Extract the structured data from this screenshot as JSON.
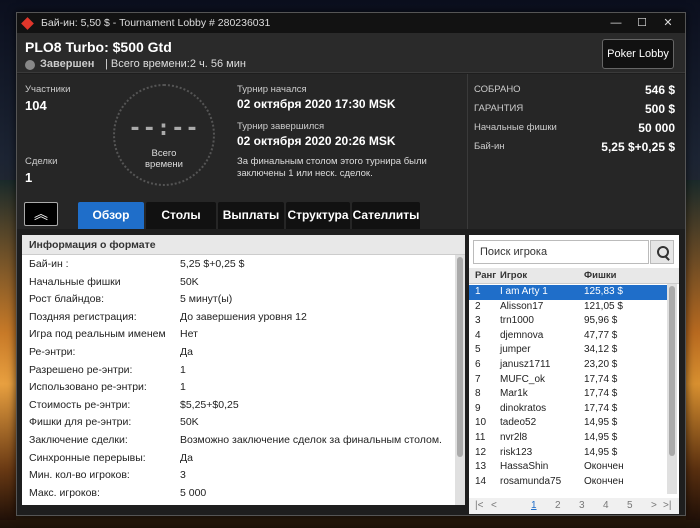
{
  "window": {
    "title": "Бай-ин: 5,50 $ - Tournament Lobby # 280236031"
  },
  "header": {
    "tournament_name": "PLO8 Turbo: $500 Gtd",
    "status": "Завершен",
    "total_time": "| Всего времени:2 ч. 56 мин",
    "poker_lobby_button": "Poker Lobby"
  },
  "stats": {
    "participants_label": "Участники",
    "participants_value": "104",
    "deals_label": "Сделки",
    "deals_value": "1"
  },
  "clock": {
    "display": "--:--",
    "caption_line1": "Всего",
    "caption_line2": "времени"
  },
  "schedule": {
    "start_label": "Турнир начался",
    "start_value": "02 октября 2020  17:30 MSK",
    "end_label": "Турнир завершился",
    "end_value": "02 октября 2020  20:26 MSK",
    "note": "За финальным столом этого турнира были заключены 1 или неск. сделок."
  },
  "prize": {
    "collected_label": "СОБРАНО",
    "collected_value": "546 $",
    "guarantee_label": "ГАРАНТИЯ",
    "guarantee_value": "500 $",
    "chips_label": "Начальные фишки",
    "chips_value": "50 000",
    "buyin_label": "Бай-ин",
    "buyin_value": "5,25 $+0,25 $"
  },
  "tabs": [
    {
      "label": "Обзор",
      "active": true
    },
    {
      "label": "Столы",
      "active": false
    },
    {
      "label": "Выплаты",
      "active": false
    },
    {
      "label": "Структура",
      "active": false
    },
    {
      "label": "Сателлиты",
      "active": false
    }
  ],
  "format": {
    "title": "Информация о формате",
    "rows": [
      {
        "k": "Бай-ин :",
        "v": "5,25 $+0,25 $"
      },
      {
        "k": "Начальные фишки",
        "v": "50K"
      },
      {
        "k": "Рост блайндов:",
        "v": "5 минут(ы)"
      },
      {
        "k": "Поздняя регистрация:",
        "v": "До завершения уровня 12"
      },
      {
        "k": "Игра под реальным именем",
        "v": "Нет"
      },
      {
        "k": "Ре-энтри:",
        "v": "Да"
      },
      {
        "k": "Разрешено ре-энтри:",
        "v": "1"
      },
      {
        "k": "Использовано ре-энтри:",
        "v": "1"
      },
      {
        "k": "Стоимость ре-энтри:",
        "v": "$5,25+$0,25"
      },
      {
        "k": "Фишки для ре-энтри:",
        "v": "50K"
      },
      {
        "k": "Заключение сделки:",
        "v": "Возможно заключение сделок за финальным столом."
      },
      {
        "k": "Синхронные перерывы:",
        "v": "Да"
      },
      {
        "k": "Мин. кол-во игроков:",
        "v": "3"
      },
      {
        "k": "Макс. игроков:",
        "v": "5 000"
      }
    ]
  },
  "players": {
    "search_placeholder": "Поиск игрока",
    "headers": {
      "rank": "Ранг",
      "player": "Игрок",
      "chips": "Фишки"
    },
    "rows": [
      {
        "rank": "1",
        "name": "I am Arty 1",
        "chips": "125,83 $"
      },
      {
        "rank": "2",
        "name": "Alisson17",
        "chips": "121,05 $"
      },
      {
        "rank": "3",
        "name": "trn1000",
        "chips": "95,96 $"
      },
      {
        "rank": "4",
        "name": "djemnova",
        "chips": "47,77 $"
      },
      {
        "rank": "5",
        "name": "jumper",
        "chips": "34,12 $"
      },
      {
        "rank": "6",
        "name": "janusz1711",
        "chips": "23,20 $"
      },
      {
        "rank": "7",
        "name": "MUFC_ok",
        "chips": "17,74 $"
      },
      {
        "rank": "8",
        "name": "Mar1k",
        "chips": "17,74 $"
      },
      {
        "rank": "9",
        "name": "dinokratos",
        "chips": "17,74 $"
      },
      {
        "rank": "10",
        "name": "tadeo52",
        "chips": "14,95 $"
      },
      {
        "rank": "11",
        "name": "nvr2l8",
        "chips": "14,95 $"
      },
      {
        "rank": "12",
        "name": "risk123",
        "chips": "14,95 $"
      },
      {
        "rank": "13",
        "name": "HassaShin",
        "chips": "Окончен"
      },
      {
        "rank": "14",
        "name": "rosamunda75",
        "chips": "Окончен"
      }
    ],
    "pager": {
      "first": "|<",
      "prev": "<",
      "pages": [
        "1",
        "2",
        "3",
        "4",
        "5"
      ],
      "next": ">",
      "last": ">|"
    }
  }
}
